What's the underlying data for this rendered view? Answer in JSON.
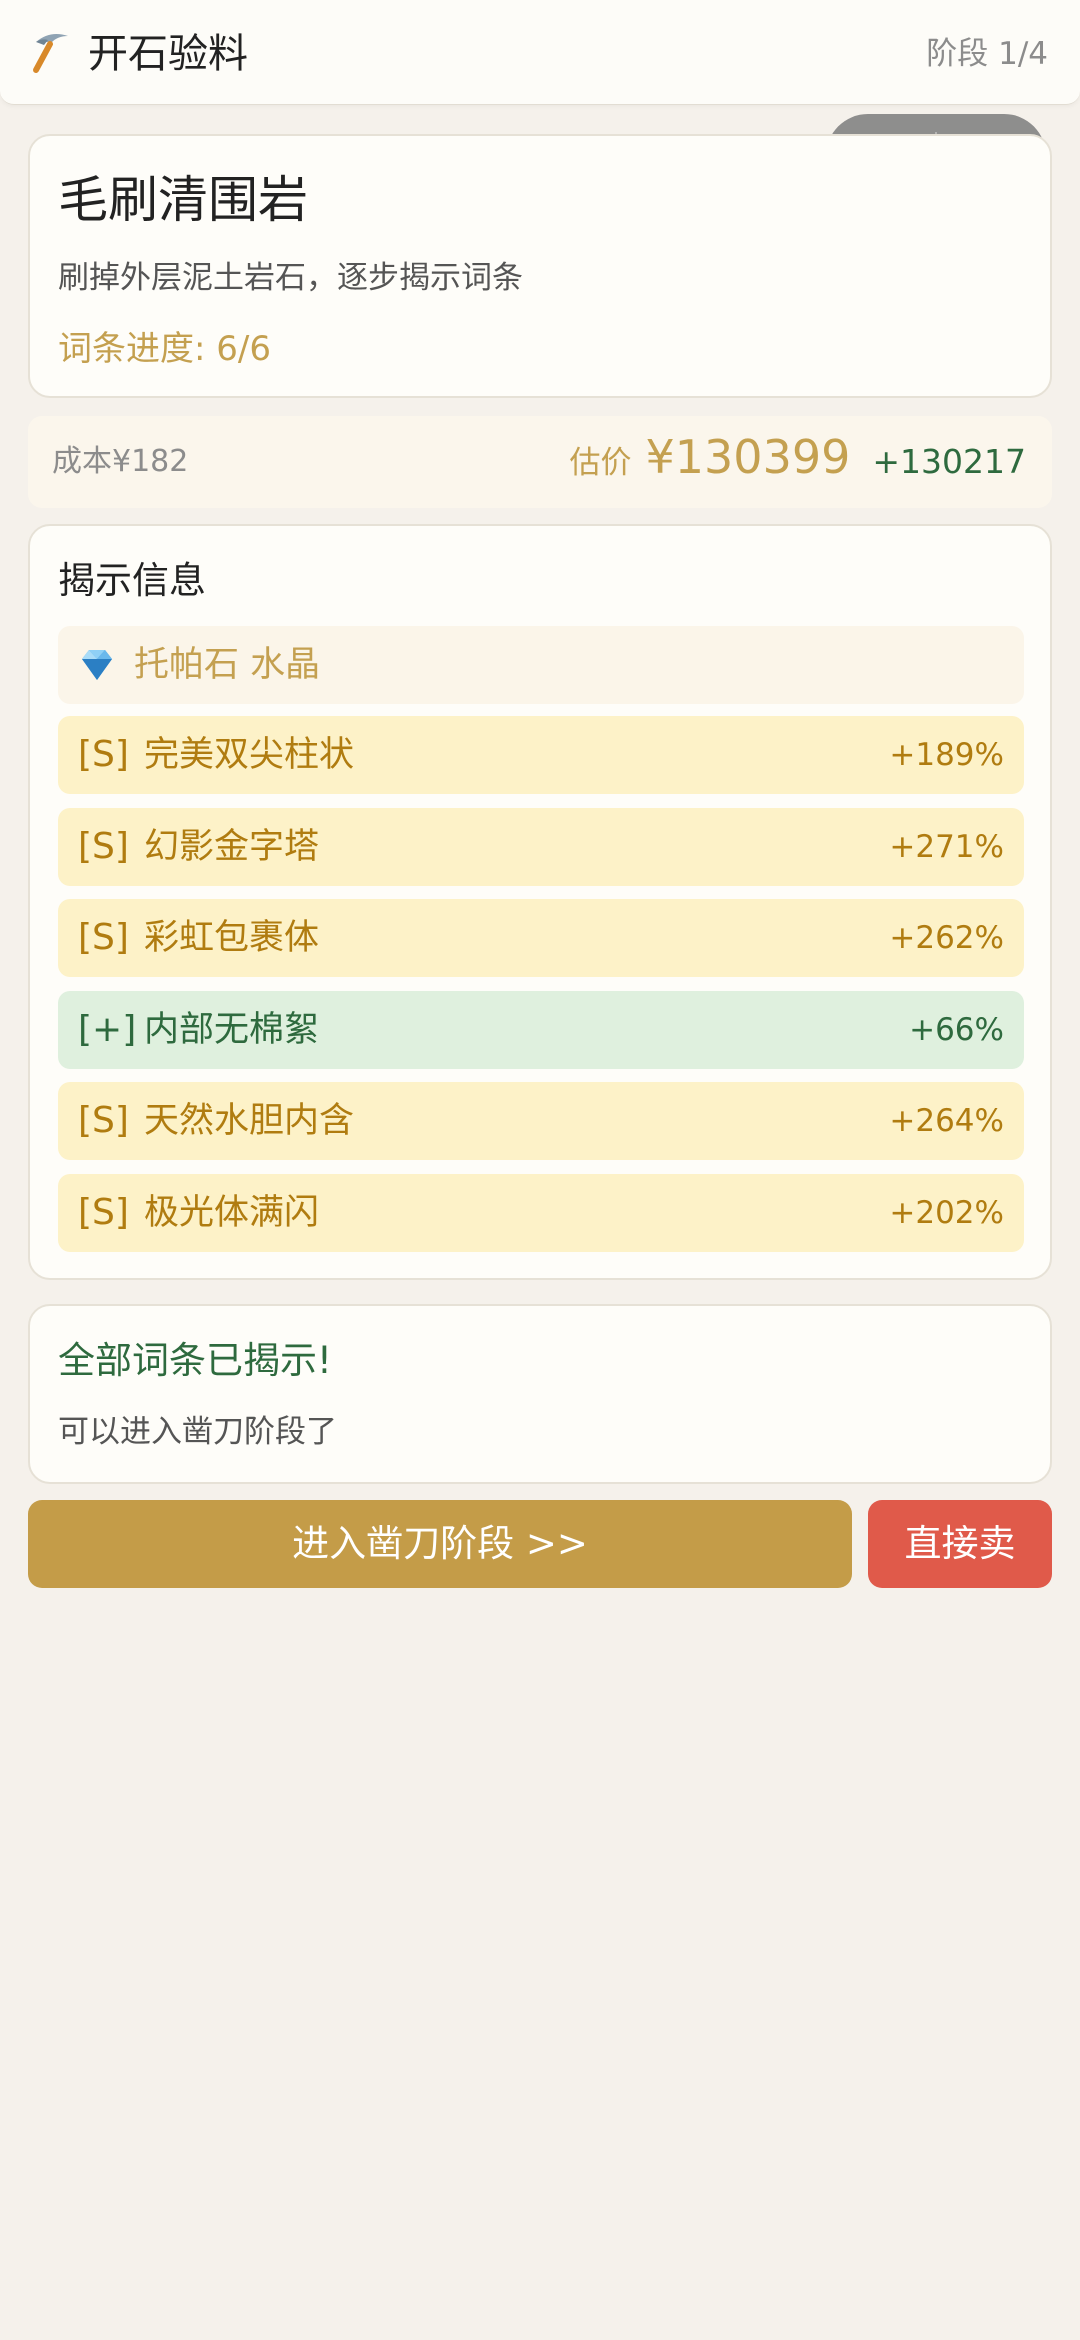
{
  "header": {
    "title": "开石验料",
    "stage": "阶段 1/4",
    "icon": "pickaxe-icon"
  },
  "main_card": {
    "title": "毛刷清围岩",
    "description": "刷掉外层泥土岩石，逐步揭示词条",
    "progress": "词条进度: 6/6"
  },
  "price": {
    "cost": "成本¥182",
    "estimate_label": "估价",
    "estimate_value": "¥130399",
    "profit": "+130217"
  },
  "reveal": {
    "heading": "揭示信息",
    "stone_icon": "gem-icon",
    "stone_name": "托帕石 水晶",
    "traits": [
      {
        "tag": "[S]",
        "name": "完美双尖柱状",
        "pct": "+189%",
        "color": "gold"
      },
      {
        "tag": "[S]",
        "name": "幻影金字塔",
        "pct": "+271%",
        "color": "gold"
      },
      {
        "tag": "[S]",
        "name": "彩虹包裹体",
        "pct": "+262%",
        "color": "gold"
      },
      {
        "tag": "[+]",
        "name": "内部无棉絮",
        "pct": "+66%",
        "color": "green"
      },
      {
        "tag": "[S]",
        "name": "天然水胆内含",
        "pct": "+264%",
        "color": "gold"
      },
      {
        "tag": "[S]",
        "name": "极光体满闪",
        "pct": "+202%",
        "color": "gold"
      }
    ]
  },
  "status": {
    "title": "全部词条已揭示!",
    "subtitle": "可以进入凿刀阶段了"
  },
  "actions": {
    "next_label": "进入凿刀阶段 >>",
    "sell_label": "直接卖"
  },
  "colors": {
    "accent_gold": "#c4a050",
    "button_gold": "#c49c48",
    "button_red": "#e05a4a",
    "positive_green": "#2e6a3e",
    "background": "#f5f1eb"
  }
}
